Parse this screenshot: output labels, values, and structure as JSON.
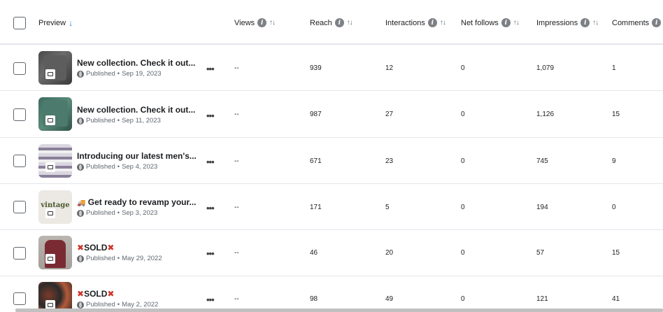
{
  "header": {
    "preview": "Preview",
    "views": "Views",
    "reach": "Reach",
    "interactions": "Interactions",
    "net_follows": "Net follows",
    "impressions": "Impressions",
    "comments": "Comments",
    "sort_icon": "↑↓",
    "sort_down": "↓",
    "info_glyph": "i"
  },
  "more_glyph": "•••",
  "rows": [
    {
      "title": "New collection. Check it out...",
      "status": "Published",
      "date": "Sep 19, 2023",
      "views": "--",
      "reach": "939",
      "interactions": "12",
      "net_follows": "0",
      "impressions": "1,079",
      "comments": "1"
    },
    {
      "title": "New collection. Check it out...",
      "status": "Published",
      "date": "Sep 11, 2023",
      "views": "--",
      "reach": "987",
      "interactions": "27",
      "net_follows": "0",
      "impressions": "1,126",
      "comments": "15"
    },
    {
      "title": "Introducing our latest men's...",
      "status": "Published",
      "date": "Sep 4, 2023",
      "views": "--",
      "reach": "671",
      "interactions": "23",
      "net_follows": "0",
      "impressions": "745",
      "comments": "9"
    },
    {
      "title": "Get ready to revamp your...",
      "status": "Published",
      "date": "Sep 3, 2023",
      "views": "--",
      "reach": "171",
      "interactions": "5",
      "net_follows": "0",
      "impressions": "194",
      "comments": "0",
      "thumb_text": "vintage"
    },
    {
      "title": "SOLD",
      "status": "Published",
      "date": "May 29, 2022",
      "views": "--",
      "reach": "46",
      "interactions": "20",
      "net_follows": "0",
      "impressions": "57",
      "comments": "15"
    },
    {
      "title": "SOLD",
      "status": "Published",
      "date": "May 2, 2022",
      "views": "--",
      "reach": "98",
      "interactions": "49",
      "net_follows": "0",
      "impressions": "121",
      "comments": "41"
    }
  ],
  "sep": "•",
  "x_glyph": "✖",
  "truck_glyph": "🚚",
  "colors": {
    "accent": "#1877f2",
    "sold_x": "#d0352a"
  }
}
